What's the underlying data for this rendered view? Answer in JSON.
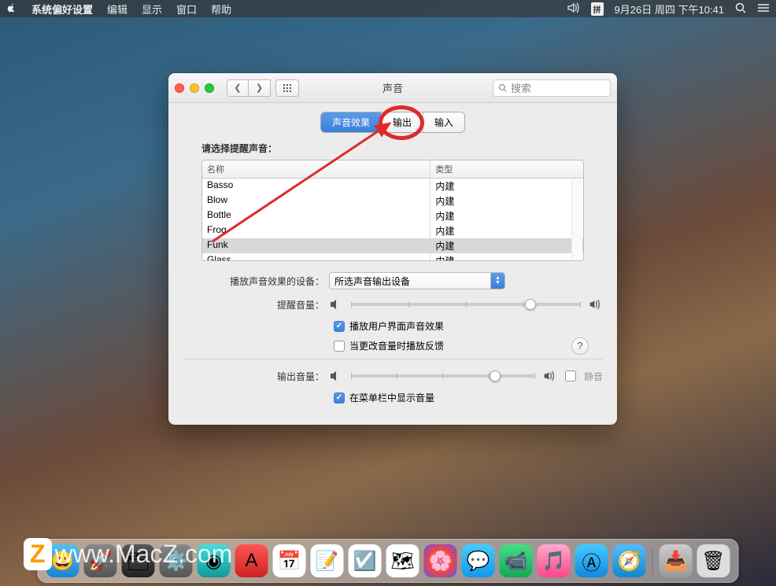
{
  "menubar": {
    "app_name": "系统偏好设置",
    "items": [
      "编辑",
      "显示",
      "窗口",
      "帮助"
    ],
    "input_method": "拼",
    "datetime": "9月26日 周四 下午10:41"
  },
  "window": {
    "title": "声音",
    "search_placeholder": "搜索"
  },
  "tabs": {
    "effects": "声音效果",
    "output": "输出",
    "input": "输入"
  },
  "content": {
    "select_alert_label": "请选择提醒声音：",
    "columns": {
      "name": "名称",
      "type": "类型"
    },
    "sounds": [
      {
        "name": "Basso",
        "type": "内建"
      },
      {
        "name": "Blow",
        "type": "内建"
      },
      {
        "name": "Bottle",
        "type": "内建"
      },
      {
        "name": "Frog",
        "type": "内建"
      },
      {
        "name": "Funk",
        "type": "内建",
        "selected": true
      },
      {
        "name": "Glass",
        "type": "内建"
      }
    ],
    "play_through_label": "播放声音效果的设备：",
    "play_through_value": "所选声音输出设备",
    "alert_volume_label": "提醒音量：",
    "alert_volume_percent": 78,
    "play_ui_effects": {
      "label": "播放用户界面声音效果",
      "checked": true
    },
    "volume_feedback": {
      "label": "当更改音量时播放反馈",
      "checked": false
    },
    "output_volume_label": "输出音量：",
    "output_volume_percent": 78,
    "mute": {
      "label": "静音",
      "checked": false
    },
    "show_in_menubar": {
      "label": "在菜单栏中显示音量",
      "checked": true
    }
  },
  "watermark": "www.MacZ.com"
}
